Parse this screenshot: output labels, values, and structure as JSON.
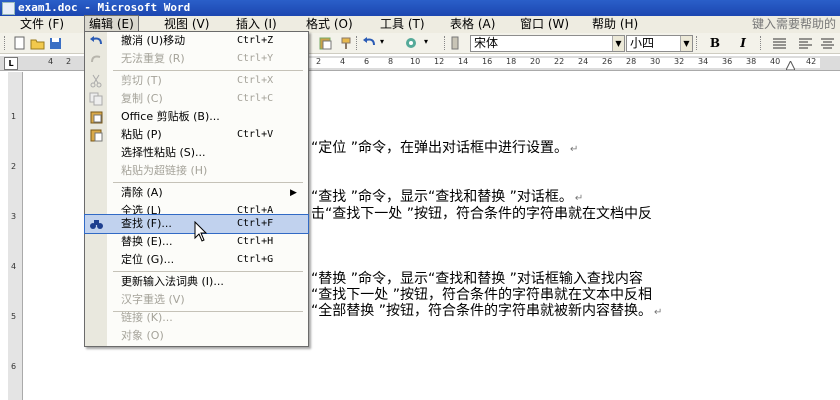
{
  "window": {
    "title": "exam1.doc - Microsoft Word"
  },
  "menubar": {
    "items": [
      {
        "label": "文件 (F)"
      },
      {
        "label": "编辑 (E)"
      },
      {
        "label": "视图 (V)"
      },
      {
        "label": "插入 (I)"
      },
      {
        "label": "格式 (O)"
      },
      {
        "label": "工具 (T)"
      },
      {
        "label": "表格 (A)"
      },
      {
        "label": "窗口 (W)"
      },
      {
        "label": "帮助 (H)"
      }
    ],
    "help_box": "键入需要帮助的"
  },
  "toolbar": {
    "font_name": "宋体",
    "font_size": "小四",
    "bold_label": "B",
    "italic_label": "I"
  },
  "ruler": {
    "numbers": [
      "4",
      "2",
      "2",
      "4",
      "6",
      "8",
      "10",
      "12",
      "14",
      "16",
      "18",
      "20",
      "22",
      "24",
      "26",
      "28",
      "30",
      "32",
      "34",
      "36",
      "38",
      "40",
      "42"
    ],
    "corner": "L"
  },
  "vruler": {
    "numbers": [
      "1",
      "2",
      "3",
      "4",
      "5",
      "6"
    ]
  },
  "edit_menu": {
    "items": [
      {
        "label": "撤消 (U)移动",
        "shortcut": "Ctrl+Z",
        "disabled": false
      },
      {
        "label": "无法重复 (R)",
        "shortcut": "Ctrl+Y",
        "disabled": true
      },
      {
        "label": "剪切 (T)",
        "shortcut": "Ctrl+X",
        "disabled": true
      },
      {
        "label": "复制 (C)",
        "shortcut": "Ctrl+C",
        "disabled": true
      },
      {
        "label": "Office 剪贴板 (B)...",
        "shortcut": "",
        "disabled": false
      },
      {
        "label": "粘贴 (P)",
        "shortcut": "Ctrl+V",
        "disabled": false
      },
      {
        "label": "选择性粘贴 (S)...",
        "shortcut": "",
        "disabled": false
      },
      {
        "label": "粘贴为超链接 (H)",
        "shortcut": "",
        "disabled": true
      },
      {
        "label": "清除 (A)",
        "shortcut": "",
        "disabled": false,
        "submenu_arrow": "▶"
      },
      {
        "label": "全选 (L)",
        "shortcut": "Ctrl+A",
        "disabled": false
      },
      {
        "label": "查找 (F)...",
        "shortcut": "Ctrl+F",
        "disabled": false,
        "highlighted": true
      },
      {
        "label": "替换 (E)...",
        "shortcut": "Ctrl+H",
        "disabled": false
      },
      {
        "label": "定位 (G)...",
        "shortcut": "Ctrl+G",
        "disabled": false
      },
      {
        "label": "更新输入法词典 (I)...",
        "shortcut": "",
        "disabled": false
      },
      {
        "label": "汉字重选 (V)",
        "shortcut": "",
        "disabled": true
      },
      {
        "label": "链接 (K)...",
        "shortcut": "",
        "disabled": true
      },
      {
        "label": "对象 (O)",
        "shortcut": "",
        "disabled": true
      }
    ]
  },
  "document": {
    "lines": [
      "“定位 ”命令，在弹出对话框中进行设置。",
      "“查找 ”命令，显示“查找和替换 ”对话框。",
      "击“查找下一处 ”按钮，符合条件的字符串就在文档中反",
      "“替换 ”命令，显示“查找和替换 ”对话框输入查找内容",
      "“查找下一处 ”按钮，符合条件的字符串就在文本中反相",
      "“全部替换 ”按钮，符合条件的字符串就被新内容替换。"
    ],
    "paragraph_mark": "↵"
  }
}
